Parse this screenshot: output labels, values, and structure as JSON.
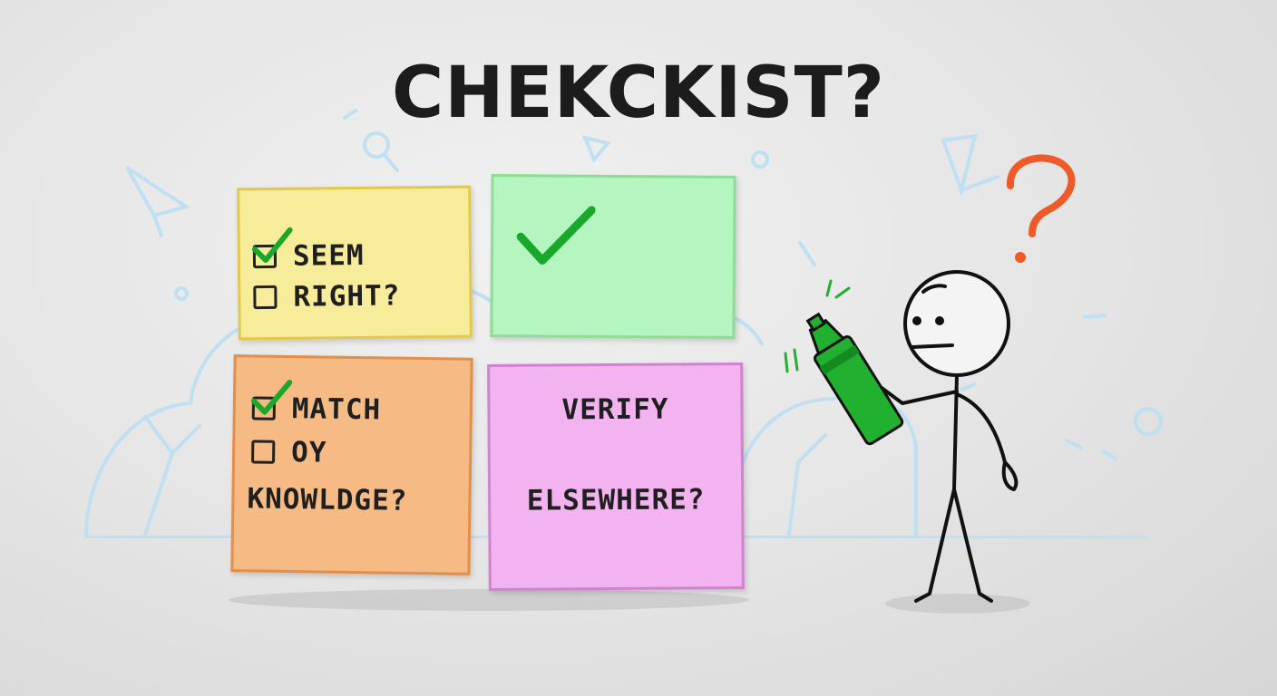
{
  "title": "CHEKCKIST?",
  "notes": {
    "yellow": {
      "item1": "SEEM",
      "item2": "RIGHT?"
    },
    "orange": {
      "item1": "MATCH",
      "item2": "OY",
      "item3": "KNOWLDGE?"
    },
    "pink": {
      "line1": "VERIFY",
      "line2": "ELSEWHERE?"
    }
  },
  "colors": {
    "yellow_note": "#f6ec9a",
    "green_note": "#b4f5c0",
    "orange_note": "#f6bb85",
    "pink_note": "#f3b3f0",
    "check": "#1aa82a",
    "marker": "#22b030",
    "question_mark": "#f05a28",
    "doodle": "#bfe0f2"
  },
  "icons": {
    "checkmark": "check-icon",
    "question_mark": "question-mark-icon",
    "marker": "highlighter-marker",
    "figure": "stick-figure"
  }
}
